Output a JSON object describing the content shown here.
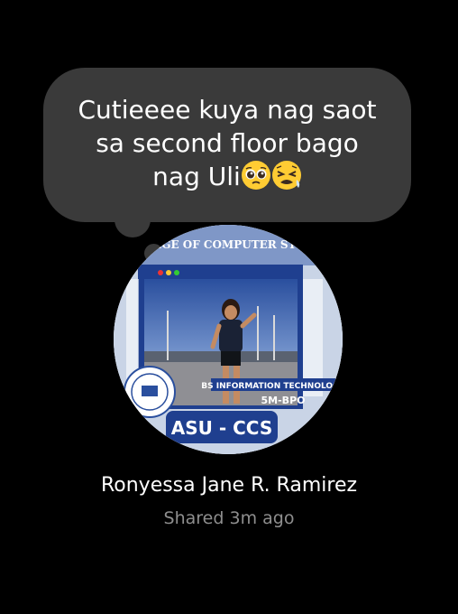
{
  "note": {
    "line1": "Cutieeee kuya nag saot",
    "line2": "sa second floor bago",
    "line3": "nag Uli",
    "emoji_1": "pleading-face-icon",
    "emoji_2": "tired-face-icon"
  },
  "profile": {
    "name": "Ronyessa Jane R. Ramirez",
    "shared": "Shared 3m ago"
  },
  "avatar_frame": {
    "header": "COLLEGE OF COMPUTER STUDIES",
    "program": "BS INFORMATION TECHNOLOGY",
    "section": "5M-BPO",
    "logo": "ASU - CCS"
  },
  "colors": {
    "bubble": "#3a3a3a",
    "text": "#ffffff",
    "subtext": "#8e8e8e",
    "frame_blue": "#1f3f8f"
  }
}
